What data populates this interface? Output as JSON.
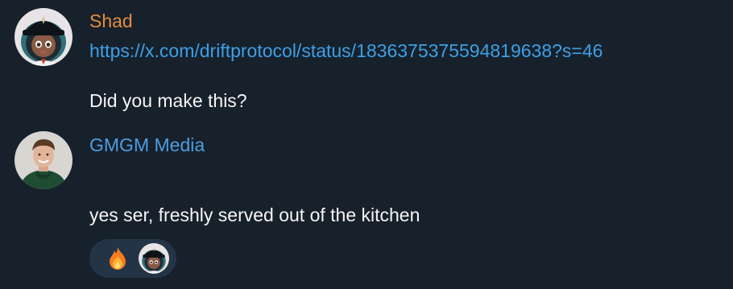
{
  "messages": [
    {
      "sender": "Shad",
      "sender_color": "#e38d3c",
      "avatar_icon": "cartoon-girl-black-hat-avatar",
      "link": "https://x.com/driftprotocol/status/1836375375594819638?s=46",
      "text": "Did you make this?"
    },
    {
      "sender": "GMGM Media",
      "sender_color": "#4c9ce2",
      "avatar_icon": "young-man-green-hoodie-avatar",
      "text": "yes ser, freshly served out of the kitchen",
      "reaction": {
        "emoji": "🔥",
        "emoji_icon": "fire-icon",
        "reactor_avatar_icon": "cartoon-girl-black-hat-avatar"
      }
    }
  ],
  "colors": {
    "background": "#17212b",
    "text": "#f5f5f5",
    "link": "#3e9fe6",
    "reaction_bg": "#243447"
  }
}
